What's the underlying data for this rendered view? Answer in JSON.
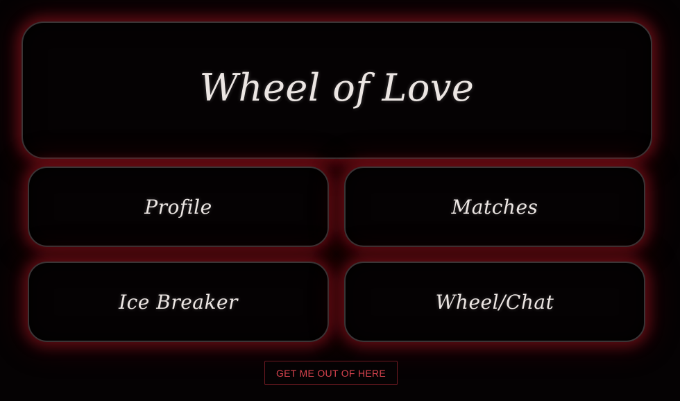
{
  "app": {
    "title": "Wheel of Love"
  },
  "menu": {
    "items": [
      {
        "label": "Profile"
      },
      {
        "label": "Matches"
      },
      {
        "label": "Ice Breaker"
      },
      {
        "label": "Wheel/Chat"
      }
    ]
  },
  "actions": {
    "exit_label": "GET ME OUT OF HERE"
  },
  "colors": {
    "background": "#050203",
    "border": "#3a3536",
    "glow": "#96141e",
    "text": "#ece6e3",
    "exit_text": "#d8434e",
    "exit_border": "#6e1a22"
  }
}
